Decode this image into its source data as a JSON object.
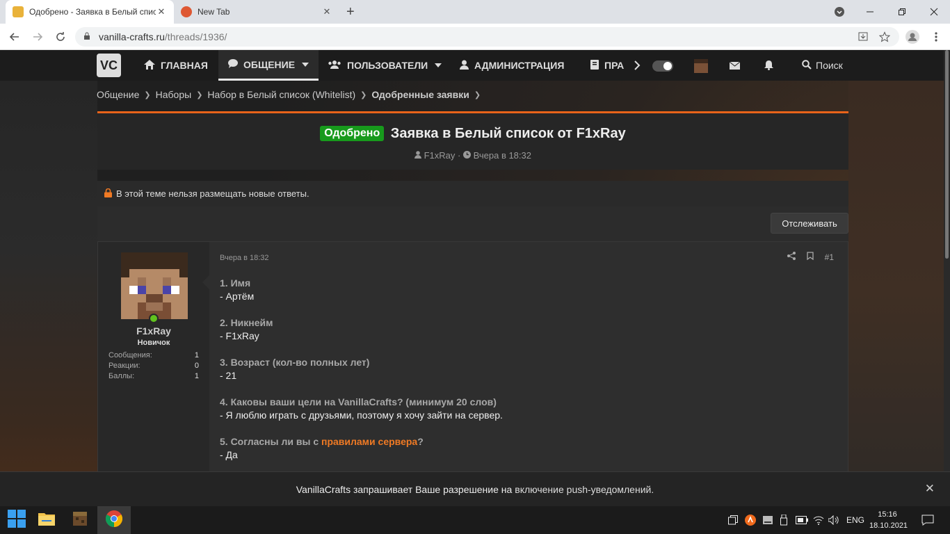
{
  "browser": {
    "tabs": [
      {
        "title": "Одобрено - Заявка в Белый спис",
        "close": "✕"
      },
      {
        "title": "New Tab",
        "close": "✕"
      }
    ],
    "new_tab": "+",
    "url_host": "vanilla-crafts.ru",
    "url_path": "/threads/1936/"
  },
  "nav": {
    "logo": "VC",
    "items": [
      {
        "label": "Главная"
      },
      {
        "label": "Общение"
      },
      {
        "label": "Пользователи"
      },
      {
        "label": "Администрация"
      },
      {
        "label": "Пра"
      }
    ],
    "search": "Поиск"
  },
  "breadcrumb": [
    "Общение",
    "Наборы",
    "Набор в Белый список (Whitelist)",
    "Одобренные заявки"
  ],
  "thread": {
    "label": "Одобрено",
    "title": "Заявка в Белый список от F1xRay",
    "author": "F1xRay",
    "sep": "·",
    "date": "Вчера в 18:32",
    "locked_notice": "В этой теме нельзя размещать новые ответы.",
    "watch_button": "Отслеживать"
  },
  "post": {
    "user": {
      "name": "F1xRay",
      "title": "Новичок",
      "stats": [
        {
          "label": "Сообщения:",
          "value": "1"
        },
        {
          "label": "Реакции:",
          "value": "0"
        },
        {
          "label": "Баллы:",
          "value": "1"
        }
      ]
    },
    "date": "Вчера в 18:32",
    "number": "#1",
    "qa": [
      {
        "q": "1. Имя",
        "a": "- Артём"
      },
      {
        "q": "2. Никнейм",
        "a": "- F1xRay"
      },
      {
        "q": "3. Возраст (кол-во полных лет)",
        "a": "- 21"
      },
      {
        "q": "4. Каковы ваши цели на VanillaCrafts? (минимум 20 слов)",
        "a": "- Я люблю играть с друзьями, поэтому я хочу зайти на сервер."
      }
    ],
    "q5_prefix": "5. Согласны ли вы с ",
    "q5_link": "правилами сервера",
    "q5_suffix": "?",
    "a5": "- Да"
  },
  "push": {
    "text": "VanillaCrafts запрашивает Ваше разрешение на",
    "link": "включение push-уведомлений.",
    "close": "✕"
  },
  "taskbar": {
    "lang": "ENG",
    "time": "15:16",
    "date": "18.10.2021"
  },
  "colors": {
    "accent": "#e8631a",
    "approved": "#179a1c",
    "online": "#61c21e"
  }
}
